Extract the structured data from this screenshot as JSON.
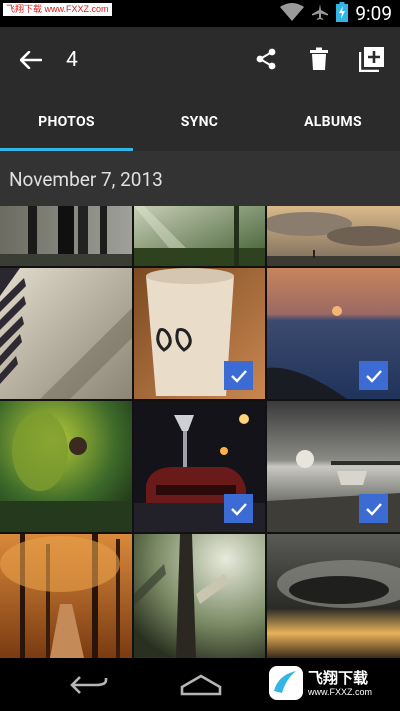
{
  "status_bar": {
    "time": "9:09",
    "watermark": "飞翔下载 www.FXXZ.com",
    "icons": [
      "wifi-icon",
      "airplane-mode-icon",
      "battery-charging-icon"
    ]
  },
  "action_bar": {
    "selected_count": "4",
    "icons": [
      "back-arrow-icon",
      "share-icon",
      "delete-icon",
      "add-to-album-icon"
    ]
  },
  "tabs": [
    {
      "label": "PHOTOS",
      "active": true
    },
    {
      "label": "SYNC",
      "active": false
    },
    {
      "label": "ALBUMS",
      "active": false
    }
  ],
  "section": {
    "date": "November 7, 2013"
  },
  "photos": [
    {
      "subject": "dark forest trees",
      "selected": false
    },
    {
      "subject": "sunbeams through trees",
      "selected": false
    },
    {
      "subject": "cloudy sky over field",
      "selected": false
    },
    {
      "subject": "window blinds shadow",
      "selected": false
    },
    {
      "subject": "coffee cup",
      "selected": true
    },
    {
      "subject": "sunset over sea",
      "selected": true
    },
    {
      "subject": "person with leaves",
      "selected": false
    },
    {
      "subject": "car at night",
      "selected": true
    },
    {
      "subject": "beach with boat",
      "selected": true
    },
    {
      "subject": "autumn trees",
      "selected": false
    },
    {
      "subject": "tree trunk",
      "selected": false
    },
    {
      "subject": "storm cloud",
      "selected": false
    }
  ],
  "nav_bar": {
    "icons": [
      "back-nav-icon",
      "home-nav-icon"
    ],
    "logo_text": "飞翔下载",
    "logo_url": "www.FXXZ.com"
  },
  "colors": {
    "accent": "#33b5e5",
    "check_badge": "#3d6bd4",
    "action_bar": "#2b2b2b",
    "date_header": "#333333"
  }
}
